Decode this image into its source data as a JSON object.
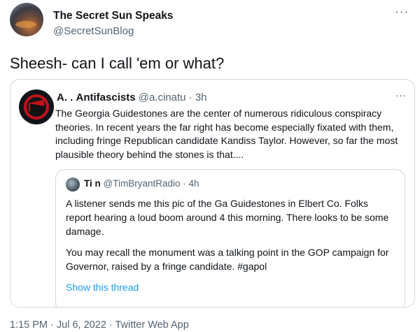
{
  "tweet": {
    "author": {
      "name": "The Secret Sun Speaks",
      "handle": "@SecretSunBlog"
    },
    "more_glyph": "···",
    "text": "Sheesh- can I call 'em or what?",
    "footer": {
      "time": "1:15 PM",
      "date": "Jul 6, 2022",
      "source": "Twitter Web App",
      "separator": " · "
    }
  },
  "quoted_tweet": {
    "name": "Antifascists",
    "name_prefix": "A.  .",
    "handle": "@a.cinatu",
    "time": "3h",
    "more_glyph": "···",
    "text": "The Georgia Guidestones are the center of numerous ridiculous conspiracy theories. In recent years the far right has become especially fixated with them, including fringe Republican candidate Kandiss Taylor. However, so far the most plausible theory behind the stones is that....",
    "nested": {
      "name": "Ti        n",
      "handle": "@TimBryantRadio",
      "time": "4h",
      "text_p1": "A listener sends me this pic of the Ga Guidestones in Elbert Co. Folks report hearing a loud boom around 4 this morning. There looks to be some damage.",
      "text_p2": "You may recall the monument was a talking point in the GOP campaign for Governor, raised by a fringe candidate. #gapol",
      "show_thread": "Show this thread"
    }
  },
  "colors": {
    "text": "#0f1419",
    "secondary": "#536471",
    "link": "#1d9bf0",
    "border": "#cfd9de"
  }
}
